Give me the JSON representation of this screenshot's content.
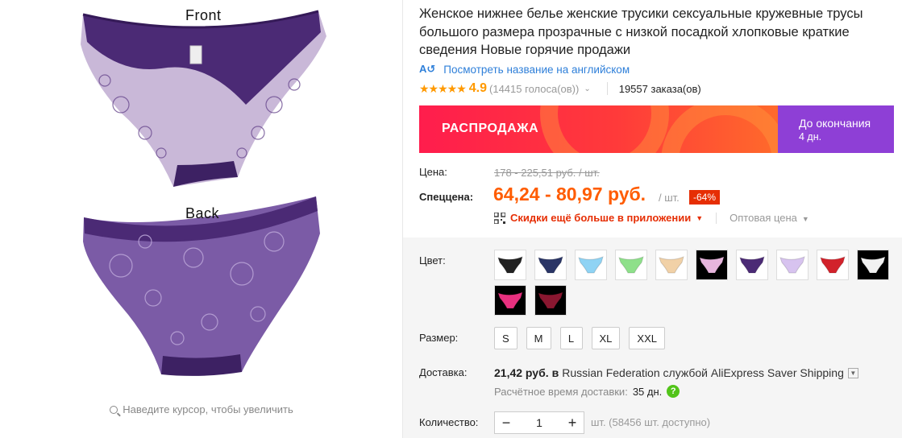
{
  "gallery": {
    "front_label": "Front",
    "back_label": "Back",
    "zoom_hint": "Наведите курсор, чтобы увеличить"
  },
  "product": {
    "title": "Женское нижнее белье женские трусики сексуальные кружевные трусы большого размера прозрачные с низкой посадкой хлопковые краткие сведения Новые горячие продажи",
    "translate_link": "Посмотреть название на английском",
    "rating_stars": "★★★★★",
    "rating_score": "4.9",
    "votes": "(14415 голоса(ов))",
    "orders": "19557 заказа(ов)"
  },
  "sale": {
    "banner_label": "РАСПРОДАЖА",
    "countdown_label": "До окончания",
    "countdown_value": "4 дн.",
    "accent_color": "#ff1d4d",
    "countdown_color": "#8e3fd6"
  },
  "price": {
    "label": "Цена:",
    "old": "178 - 225,51 руб. / шт.",
    "special_label": "Спеццена:",
    "new": "64,24 - 80,97 руб.",
    "per_unit": "/ шт.",
    "discount": "-64%",
    "app_discount": "Скидки ещё больше в приложении",
    "wholesale": "Оптовая цена"
  },
  "options": {
    "color_label": "Цвет:",
    "colors": [
      {
        "name": "black",
        "fill": "#222222",
        "dark_bg": false
      },
      {
        "name": "navy",
        "fill": "#2a3566",
        "dark_bg": false
      },
      {
        "name": "sky-blue",
        "fill": "#8fd3f4",
        "dark_bg": false
      },
      {
        "name": "green",
        "fill": "#8ee08a",
        "dark_bg": false
      },
      {
        "name": "beige",
        "fill": "#f1d1a7",
        "dark_bg": false
      },
      {
        "name": "pink",
        "fill": "#e7b6dd",
        "dark_bg": true
      },
      {
        "name": "purple",
        "fill": "#4b2a75",
        "dark_bg": false
      },
      {
        "name": "lavender",
        "fill": "#d7c3ef",
        "dark_bg": false
      },
      {
        "name": "red",
        "fill": "#d2222b",
        "dark_bg": false
      },
      {
        "name": "white",
        "fill": "#f2f2f2",
        "dark_bg": true
      },
      {
        "name": "hot-pink",
        "fill": "#e8307f",
        "dark_bg": true
      },
      {
        "name": "wine",
        "fill": "#8a1730",
        "dark_bg": true
      }
    ],
    "size_label": "Размер:",
    "sizes": [
      "S",
      "M",
      "L",
      "XL",
      "XXL"
    ]
  },
  "shipping": {
    "label": "Доставка:",
    "price": "21,42 руб.",
    "via": "в",
    "carrier": "Russian Federation службой AliExpress Saver Shipping",
    "est_label": "Расчётное время доставки:",
    "est_value": "35 дн.",
    "help": "?"
  },
  "quantity": {
    "label": "Количество:",
    "minus": "−",
    "value": "1",
    "plus": "+",
    "available": "шт. (58456 шт. доступно)"
  }
}
